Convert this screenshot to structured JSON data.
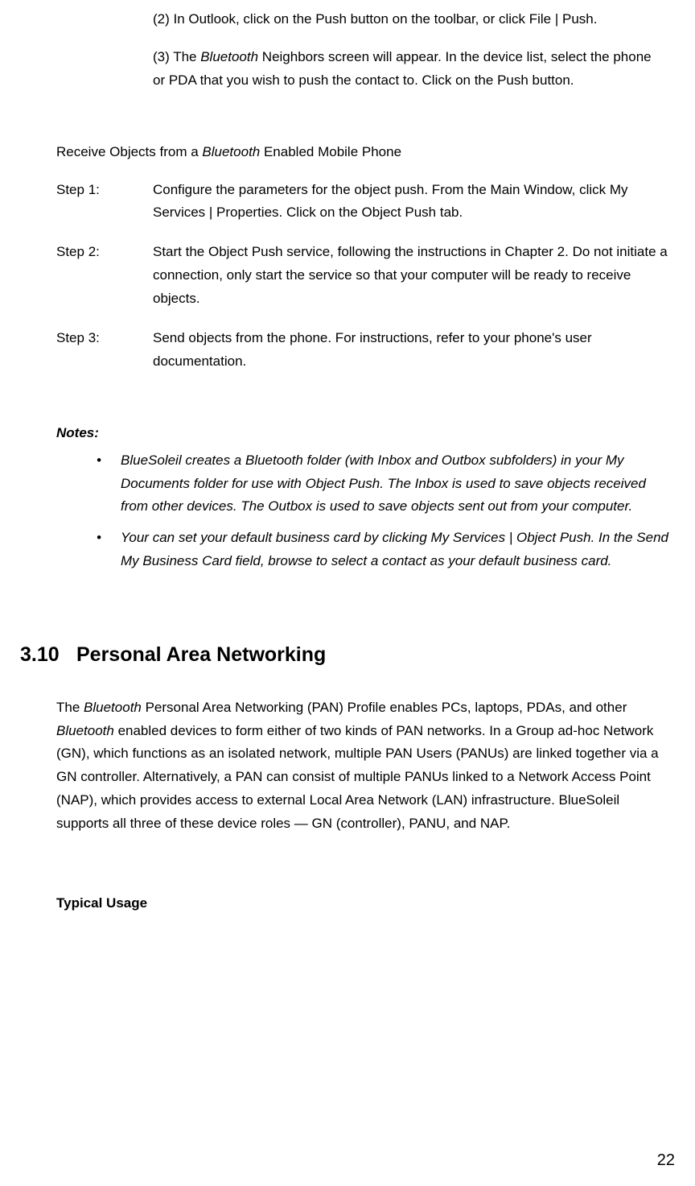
{
  "subitems": {
    "p2": "(2) In Outlook, click on the Push button on the toolbar, or click File | Push.",
    "p3_prefix": "(3) The ",
    "p3_italic": "Bluetooth",
    "p3_suffix": " Neighbors screen will appear. In the device list, select the phone or PDA that you wish to push the contact to. Click on the Push button."
  },
  "receive_heading_prefix": "Receive Objects from a ",
  "receive_heading_italic": "Bluetooth",
  "receive_heading_suffix": " Enabled Mobile Phone",
  "steps": [
    {
      "label": "Step 1:",
      "body": "Configure the parameters for the object push. From the Main Window, click My Services | Properties. Click on the Object Push tab."
    },
    {
      "label": "Step 2:",
      "body": "Start the Object Push service, following the instructions in Chapter 2. Do not initiate a connection, only start the service so that your computer will be ready to receive objects."
    },
    {
      "label": "Step 3:",
      "body": "Send objects from the phone. For instructions, refer to your phone's user documentation."
    }
  ],
  "notes_title": "Notes:",
  "notes": [
    "BlueSoleil creates a Bluetooth folder (with Inbox and Outbox subfolders) in your My Documents folder for use with Object Push. The Inbox is used to save objects received from other devices. The Outbox is used to save objects sent out from your computer.",
    "Your can set your default business card by clicking My Services | Object Push. In the Send My Business Card field, browse to select a contact as your default business card."
  ],
  "chapter": {
    "number": "3.10",
    "title": "Personal Area Networking"
  },
  "pan_p1_seg1": "The ",
  "pan_p1_it1": "Bluetooth",
  "pan_p1_seg2": " Personal Area Networking (PAN) Profile enables PCs, laptops, PDAs, and other ",
  "pan_p1_it2": "Bluetooth",
  "pan_p1_seg3": " enabled devices to form either of two kinds of PAN networks. In a Group ad-hoc Network (GN), which functions as an isolated network, multiple PAN Users (PANUs) are linked together via a GN controller. Alternatively, a PAN can consist of multiple PANUs linked to a Network Access Point (NAP), which provides access to external Local Area Network (LAN) infrastructure. BlueSoleil supports all three of these device roles — GN (controller), PANU, and NAP.",
  "typical_usage": "Typical Usage",
  "page_number": "22"
}
